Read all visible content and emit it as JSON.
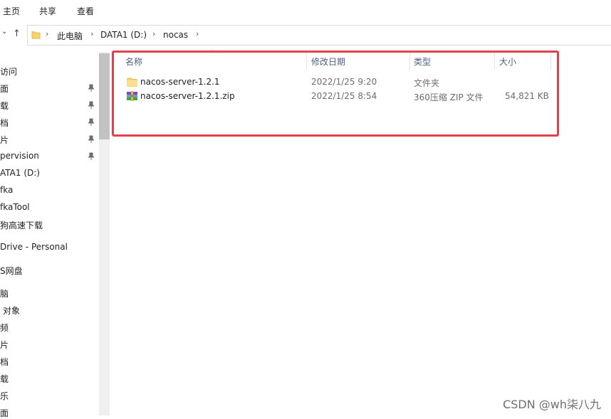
{
  "ribbon": {
    "tabs": [
      "主页",
      "共享",
      "查看"
    ]
  },
  "address": {
    "breadcrumbs": [
      "此电脑",
      "DATA1 (D:)",
      "nocas"
    ]
  },
  "nav": {
    "items": [
      {
        "label": "访问"
      },
      {
        "label": "面",
        "pinned": true
      },
      {
        "label": "载",
        "pinned": true
      },
      {
        "label": "档",
        "pinned": true
      },
      {
        "label": "片",
        "pinned": true
      },
      {
        "label": "pervision",
        "pinned": true
      },
      {
        "label": "ATA1 (D:)"
      },
      {
        "label": "fka"
      },
      {
        "label": "fkaTool"
      },
      {
        "label": "狗高速下载"
      },
      {
        "label": "Drive - Personal"
      },
      {
        "label": "S网盘"
      },
      {
        "label": "脑"
      },
      {
        "label": "对象"
      },
      {
        "label": "频"
      },
      {
        "label": "片"
      },
      {
        "label": "档"
      },
      {
        "label": "载"
      },
      {
        "label": "乐"
      },
      {
        "label": "面"
      }
    ]
  },
  "files": {
    "columns": [
      "名称",
      "修改日期",
      "类型",
      "大小"
    ],
    "rows": [
      {
        "name": "nacos-server-1.2.1",
        "date": "2022/1/25 9:20",
        "type": "文件夹",
        "size": "",
        "icon": "folder-icon"
      },
      {
        "name": "nacos-server-1.2.1.zip",
        "date": "2022/1/25 8:54",
        "type": "360压缩 ZIP 文件",
        "size": "54,821 KB",
        "icon": "zip-archive-icon"
      }
    ]
  },
  "highlight_color": "#e0424b",
  "watermark": "CSDN @wh柒八九"
}
